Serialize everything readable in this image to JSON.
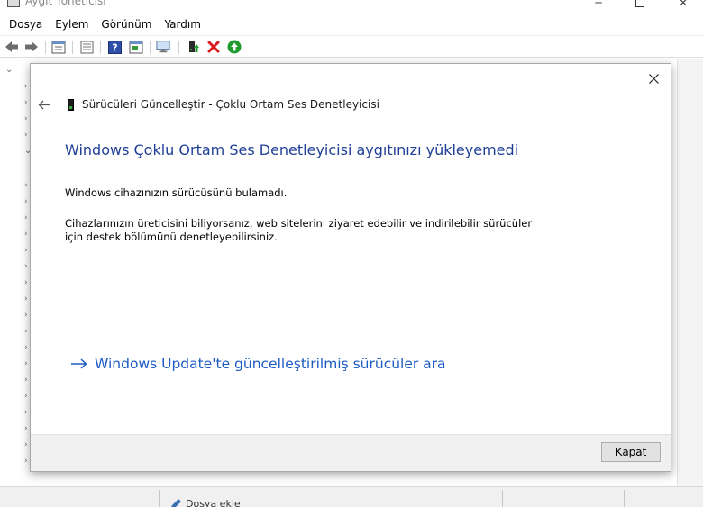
{
  "window": {
    "title": "Aygıt Yöneticisi",
    "controls": {
      "minimize": "─",
      "close": "✕"
    }
  },
  "menubar": {
    "items": [
      "Dosya",
      "Eylem",
      "Görünüm",
      "Yardım"
    ]
  },
  "toolbar": {
    "icons": [
      "back-icon",
      "forward-icon",
      "properties-icon",
      "list-icon",
      "help-icon",
      "view-icon",
      "monitor-icon",
      "update-driver-icon",
      "remove-device-icon",
      "enable-device-icon"
    ],
    "colors": {
      "remove": "#d9191b",
      "enable": "#1f9a2c",
      "help": "#2e4fa8"
    }
  },
  "tree": {
    "expander_open": "⌄",
    "expander_closed": "›"
  },
  "statusbar": {
    "text": "Dosya ekle"
  },
  "dialog": {
    "header_title": "Sürücüleri Güncelleştir - Çoklu Ortam Ses Denetleyicisi",
    "heading": "Windows Çoklu Ortam Ses Denetleyicisi aygıtınızı yükleyemedi",
    "message1": "Windows cihazınızın sürücüsünü bulamadı.",
    "message2": "Cihazlarınızın üreticisini biliyorsanız, web sitelerini ziyaret edebilir ve indirilebilir sürücüler için destek bölümünü denetleyebilirsiniz.",
    "link_text": "Windows Update'te güncelleştirilmiş sürücüler ara",
    "close_button": "Kapat",
    "colors": {
      "heading": "#1f3f96",
      "link": "#1d5cc4"
    }
  }
}
